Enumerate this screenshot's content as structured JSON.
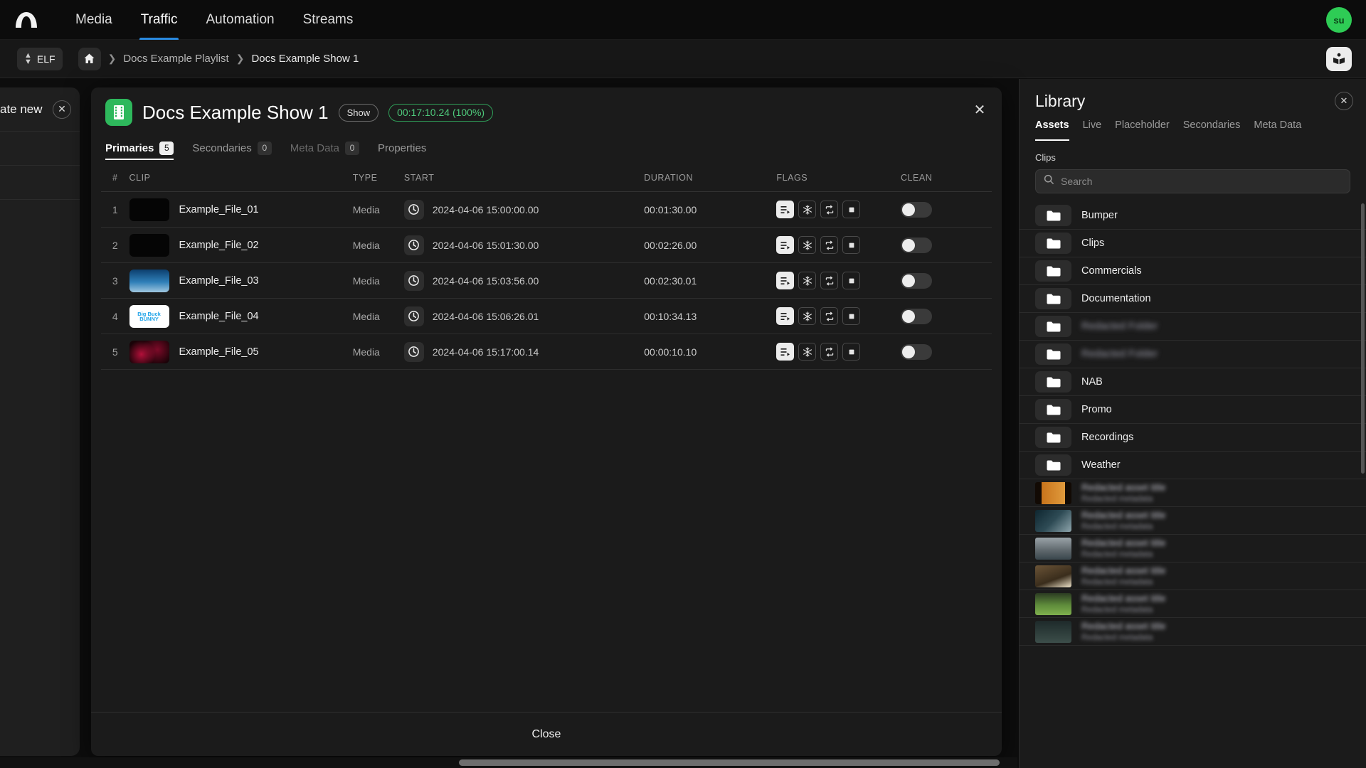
{
  "topnav": {
    "logo_icon": "arc-logo-icon",
    "items": [
      {
        "label": "Media",
        "active": false
      },
      {
        "label": "Traffic",
        "active": true
      },
      {
        "label": "Automation",
        "active": false
      },
      {
        "label": "Streams",
        "active": false
      }
    ],
    "avatar_initials": "su",
    "accent_color": "#2a8ae0"
  },
  "breadcrumb": {
    "channel_selector": "ELF",
    "home_icon": "home-icon",
    "separator": "❯",
    "items": [
      {
        "label": "Docs Example Playlist"
      },
      {
        "label": "Docs Example Show 1"
      }
    ],
    "library_toggle_icon": "book-icon"
  },
  "background_panel": {
    "title_fragment": "ate new",
    "close_icon": "close-icon"
  },
  "modal": {
    "icon": "film-strip-icon",
    "title": "Docs Example Show 1",
    "type_badge": "Show",
    "duration_badge": "00:17:10.24 (100%)",
    "duration_color": "#4ec97b",
    "close_icon": "close-icon",
    "tabs": [
      {
        "label": "Primaries",
        "count": "5",
        "active": true,
        "dim": false
      },
      {
        "label": "Secondaries",
        "count": "0",
        "active": false,
        "dim": false
      },
      {
        "label": "Meta Data",
        "count": "0",
        "active": false,
        "dim": true
      },
      {
        "label": "Properties",
        "count": null,
        "active": false,
        "dim": false
      }
    ],
    "footer_button": "Close"
  },
  "table": {
    "columns": [
      "#",
      "CLIP",
      "TYPE",
      "START",
      "DURATION",
      "FLAGS",
      "CLEAN"
    ],
    "flag_icons": [
      "playlist-icon",
      "snowflake-icon",
      "loop-icon",
      "stop-square-icon"
    ],
    "rows": [
      {
        "num": "1",
        "clip": "Example_File_01",
        "type": "Media",
        "start": "2024-04-06 15:00:00.00",
        "duration": "00:01:30.00",
        "thumb": "black",
        "flags": [
          true,
          false,
          false,
          false
        ],
        "clean": false
      },
      {
        "num": "2",
        "clip": "Example_File_02",
        "type": "Media",
        "start": "2024-04-06 15:01:30.00",
        "duration": "00:02:26.00",
        "thumb": "black",
        "flags": [
          true,
          false,
          false,
          false
        ],
        "clean": false
      },
      {
        "num": "3",
        "clip": "Example_File_03",
        "type": "Media",
        "start": "2024-04-06 15:03:56.00",
        "duration": "00:02:30.01",
        "thumb": "sky",
        "flags": [
          true,
          false,
          false,
          false
        ],
        "clean": false
      },
      {
        "num": "4",
        "clip": "Example_File_04",
        "type": "Media",
        "start": "2024-04-06 15:06:26.01",
        "duration": "00:10:34.13",
        "thumb": "bunny",
        "flags": [
          true,
          false,
          false,
          false
        ],
        "clean": false
      },
      {
        "num": "5",
        "clip": "Example_File_05",
        "type": "Media",
        "start": "2024-04-06 15:17:00.14",
        "duration": "00:00:10.10",
        "thumb": "red",
        "flags": [
          true,
          false,
          false,
          false
        ],
        "clean": false
      }
    ]
  },
  "library": {
    "title": "Library",
    "close_icon": "close-icon",
    "tabs": [
      {
        "label": "Assets",
        "active": true
      },
      {
        "label": "Live",
        "active": false
      },
      {
        "label": "Placeholder",
        "active": false
      },
      {
        "label": "Secondaries",
        "active": false
      },
      {
        "label": "Meta Data",
        "active": false
      }
    ],
    "section_label": "Clips",
    "search": {
      "value": "",
      "placeholder": "Search",
      "icon": "search-icon"
    },
    "folders": [
      {
        "name": "Bumper",
        "redacted": false
      },
      {
        "name": "Clips",
        "redacted": false
      },
      {
        "name": "Commercials",
        "redacted": false
      },
      {
        "name": "Documentation",
        "redacted": false
      },
      {
        "name": "Redacted Folder",
        "redacted": true
      },
      {
        "name": "Redacted Folder",
        "redacted": true
      },
      {
        "name": "NAB",
        "redacted": false
      },
      {
        "name": "Promo",
        "redacted": false
      },
      {
        "name": "Recordings",
        "redacted": false
      },
      {
        "name": "Weather",
        "redacted": false
      }
    ],
    "assets": [
      {
        "title": "Redacted asset title",
        "subtitle": "Redacted metadata",
        "thumb": "amber"
      },
      {
        "title": "Redacted asset title",
        "subtitle": "Redacted metadata",
        "thumb": "teal"
      },
      {
        "title": "Redacted asset title",
        "subtitle": "Redacted metadata",
        "thumb": "gray"
      },
      {
        "title": "Redacted asset title",
        "subtitle": "Redacted metadata",
        "thumb": "brown"
      },
      {
        "title": "Redacted asset title",
        "subtitle": "Redacted metadata",
        "thumb": "green"
      },
      {
        "title": "Redacted asset title",
        "subtitle": "Redacted metadata",
        "thumb": "dark"
      }
    ]
  }
}
